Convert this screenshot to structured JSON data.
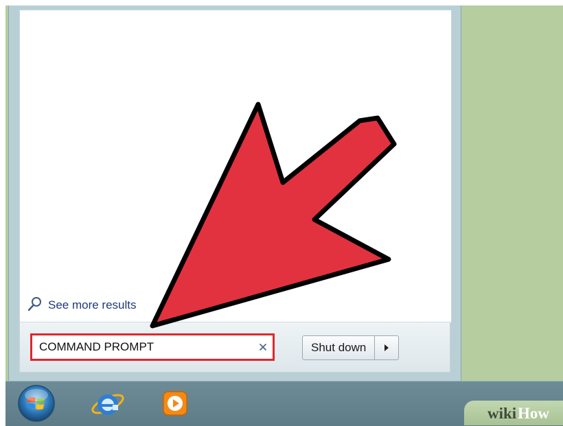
{
  "start_menu": {
    "see_more_label": "See more results",
    "search": {
      "value": "COMMAND PROMPT",
      "placeholder": ""
    },
    "shutdown_label": "Shut down"
  },
  "icons": {
    "see_more": "search-icon",
    "clear": "close-icon",
    "shutdown_arrow": "chevron-right-icon",
    "start": "windows-start-orb-icon",
    "ie": "internet-explorer-icon",
    "media": "media-player-icon"
  },
  "watermark": {
    "brand_a": "wiki",
    "brand_b": "How"
  },
  "colors": {
    "annotation_arrow": "#e2323f",
    "search_highlight": "#e0262d",
    "desktop": "#b5cd9f"
  }
}
